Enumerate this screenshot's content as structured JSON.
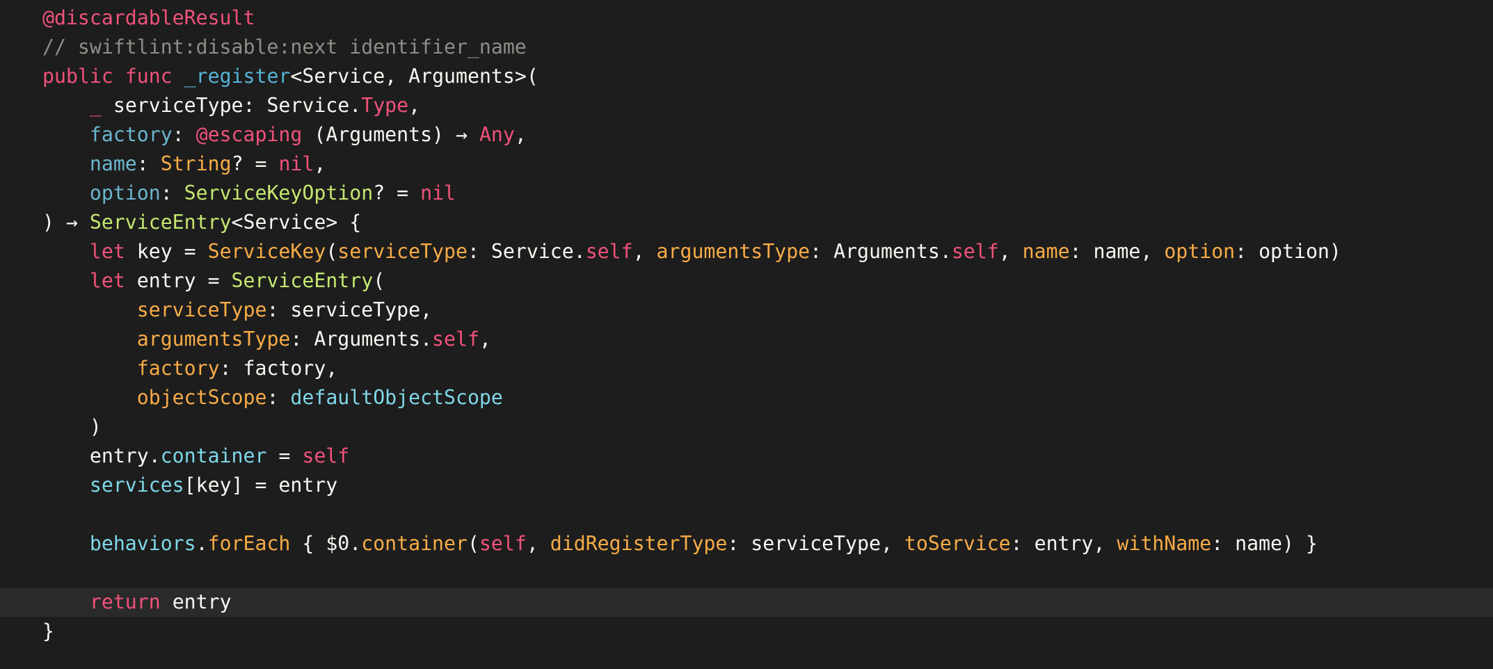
{
  "editor": {
    "language": "Swift",
    "current_line_index": 20,
    "colors": {
      "background": "#1d1d1d",
      "current_line": "#2a2a2a",
      "plain": "#f7f7f2",
      "keyword": "#f0527a",
      "comment": "#8e8e88",
      "function": "#55b4d6",
      "param_label": "#6bb7cf",
      "type": "#c5e870",
      "arg_label": "#f8ac47",
      "property": "#7fd8e8"
    },
    "lines": [
      {
        "tokens": [
          {
            "t": "@discardableResult",
            "k": "keyword"
          }
        ]
      },
      {
        "tokens": [
          {
            "t": "// swiftlint:disable:next identifier_name",
            "k": "comment"
          }
        ]
      },
      {
        "tokens": [
          {
            "t": "public",
            "k": "keyword"
          },
          {
            "t": " ",
            "k": "plain"
          },
          {
            "t": "func",
            "k": "keyword"
          },
          {
            "t": " ",
            "k": "plain"
          },
          {
            "t": "_register",
            "k": "function"
          },
          {
            "t": "<Service, Arguments>(",
            "k": "plain"
          }
        ]
      },
      {
        "tokens": [
          {
            "t": "    ",
            "k": "plain"
          },
          {
            "t": "_",
            "k": "keyword"
          },
          {
            "t": " serviceType: Service.",
            "k": "plain"
          },
          {
            "t": "Type",
            "k": "keyword"
          },
          {
            "t": ",",
            "k": "plain"
          }
        ]
      },
      {
        "tokens": [
          {
            "t": "    ",
            "k": "plain"
          },
          {
            "t": "factory",
            "k": "param_label"
          },
          {
            "t": ": ",
            "k": "plain"
          },
          {
            "t": "@escaping",
            "k": "keyword"
          },
          {
            "t": " (Arguments) → ",
            "k": "plain"
          },
          {
            "t": "Any",
            "k": "keyword"
          },
          {
            "t": ",",
            "k": "plain"
          }
        ]
      },
      {
        "tokens": [
          {
            "t": "    ",
            "k": "plain"
          },
          {
            "t": "name",
            "k": "param_label"
          },
          {
            "t": ": ",
            "k": "plain"
          },
          {
            "t": "String",
            "k": "arg_label"
          },
          {
            "t": "? = ",
            "k": "plain"
          },
          {
            "t": "nil",
            "k": "keyword"
          },
          {
            "t": ",",
            "k": "plain"
          }
        ]
      },
      {
        "tokens": [
          {
            "t": "    ",
            "k": "plain"
          },
          {
            "t": "option",
            "k": "param_label"
          },
          {
            "t": ": ",
            "k": "plain"
          },
          {
            "t": "ServiceKeyOption",
            "k": "type"
          },
          {
            "t": "? = ",
            "k": "plain"
          },
          {
            "t": "nil",
            "k": "keyword"
          }
        ]
      },
      {
        "tokens": [
          {
            "t": ") → ",
            "k": "plain"
          },
          {
            "t": "ServiceEntry",
            "k": "type"
          },
          {
            "t": "<Service> {",
            "k": "plain"
          }
        ]
      },
      {
        "tokens": [
          {
            "t": "    ",
            "k": "plain"
          },
          {
            "t": "let",
            "k": "keyword"
          },
          {
            "t": " key = ",
            "k": "plain"
          },
          {
            "t": "ServiceKey",
            "k": "arg_label"
          },
          {
            "t": "(",
            "k": "plain"
          },
          {
            "t": "serviceType",
            "k": "arg_label"
          },
          {
            "t": ": Service.",
            "k": "plain"
          },
          {
            "t": "self",
            "k": "keyword"
          },
          {
            "t": ", ",
            "k": "plain"
          },
          {
            "t": "argumentsType",
            "k": "arg_label"
          },
          {
            "t": ": Arguments.",
            "k": "plain"
          },
          {
            "t": "self",
            "k": "keyword"
          },
          {
            "t": ", ",
            "k": "plain"
          },
          {
            "t": "name",
            "k": "arg_label"
          },
          {
            "t": ": name, ",
            "k": "plain"
          },
          {
            "t": "option",
            "k": "arg_label"
          },
          {
            "t": ": option)",
            "k": "plain"
          }
        ]
      },
      {
        "tokens": [
          {
            "t": "    ",
            "k": "plain"
          },
          {
            "t": "let",
            "k": "keyword"
          },
          {
            "t": " entry = ",
            "k": "plain"
          },
          {
            "t": "ServiceEntry",
            "k": "type"
          },
          {
            "t": "(",
            "k": "plain"
          }
        ]
      },
      {
        "tokens": [
          {
            "t": "        ",
            "k": "plain"
          },
          {
            "t": "serviceType",
            "k": "arg_label"
          },
          {
            "t": ": serviceType,",
            "k": "plain"
          }
        ]
      },
      {
        "tokens": [
          {
            "t": "        ",
            "k": "plain"
          },
          {
            "t": "argumentsType",
            "k": "arg_label"
          },
          {
            "t": ": Arguments.",
            "k": "plain"
          },
          {
            "t": "self",
            "k": "keyword"
          },
          {
            "t": ",",
            "k": "plain"
          }
        ]
      },
      {
        "tokens": [
          {
            "t": "        ",
            "k": "plain"
          },
          {
            "t": "factory",
            "k": "arg_label"
          },
          {
            "t": ": factory,",
            "k": "plain"
          }
        ]
      },
      {
        "tokens": [
          {
            "t": "        ",
            "k": "plain"
          },
          {
            "t": "objectScope",
            "k": "arg_label"
          },
          {
            "t": ": ",
            "k": "plain"
          },
          {
            "t": "defaultObjectScope",
            "k": "property"
          }
        ]
      },
      {
        "tokens": [
          {
            "t": "    )",
            "k": "plain"
          }
        ]
      },
      {
        "tokens": [
          {
            "t": "    entry.",
            "k": "plain"
          },
          {
            "t": "container",
            "k": "property"
          },
          {
            "t": " = ",
            "k": "plain"
          },
          {
            "t": "self",
            "k": "keyword"
          }
        ]
      },
      {
        "tokens": [
          {
            "t": "    ",
            "k": "plain"
          },
          {
            "t": "services",
            "k": "property"
          },
          {
            "t": "[key] = entry",
            "k": "plain"
          }
        ]
      },
      {
        "tokens": []
      },
      {
        "tokens": [
          {
            "t": "    ",
            "k": "plain"
          },
          {
            "t": "behaviors",
            "k": "property"
          },
          {
            "t": ".",
            "k": "plain"
          },
          {
            "t": "forEach",
            "k": "arg_label"
          },
          {
            "t": " { $0.",
            "k": "plain"
          },
          {
            "t": "container",
            "k": "arg_label"
          },
          {
            "t": "(",
            "k": "plain"
          },
          {
            "t": "self",
            "k": "keyword"
          },
          {
            "t": ", ",
            "k": "plain"
          },
          {
            "t": "didRegisterType",
            "k": "arg_label"
          },
          {
            "t": ": serviceType, ",
            "k": "plain"
          },
          {
            "t": "toService",
            "k": "arg_label"
          },
          {
            "t": ": entry, ",
            "k": "plain"
          },
          {
            "t": "withName",
            "k": "arg_label"
          },
          {
            "t": ": name) }",
            "k": "plain"
          }
        ]
      },
      {
        "tokens": []
      },
      {
        "tokens": [
          {
            "t": "    ",
            "k": "plain"
          },
          {
            "t": "return",
            "k": "keyword"
          },
          {
            "t": " entry",
            "k": "plain"
          }
        ]
      },
      {
        "tokens": [
          {
            "t": "}",
            "k": "plain"
          }
        ]
      }
    ]
  }
}
